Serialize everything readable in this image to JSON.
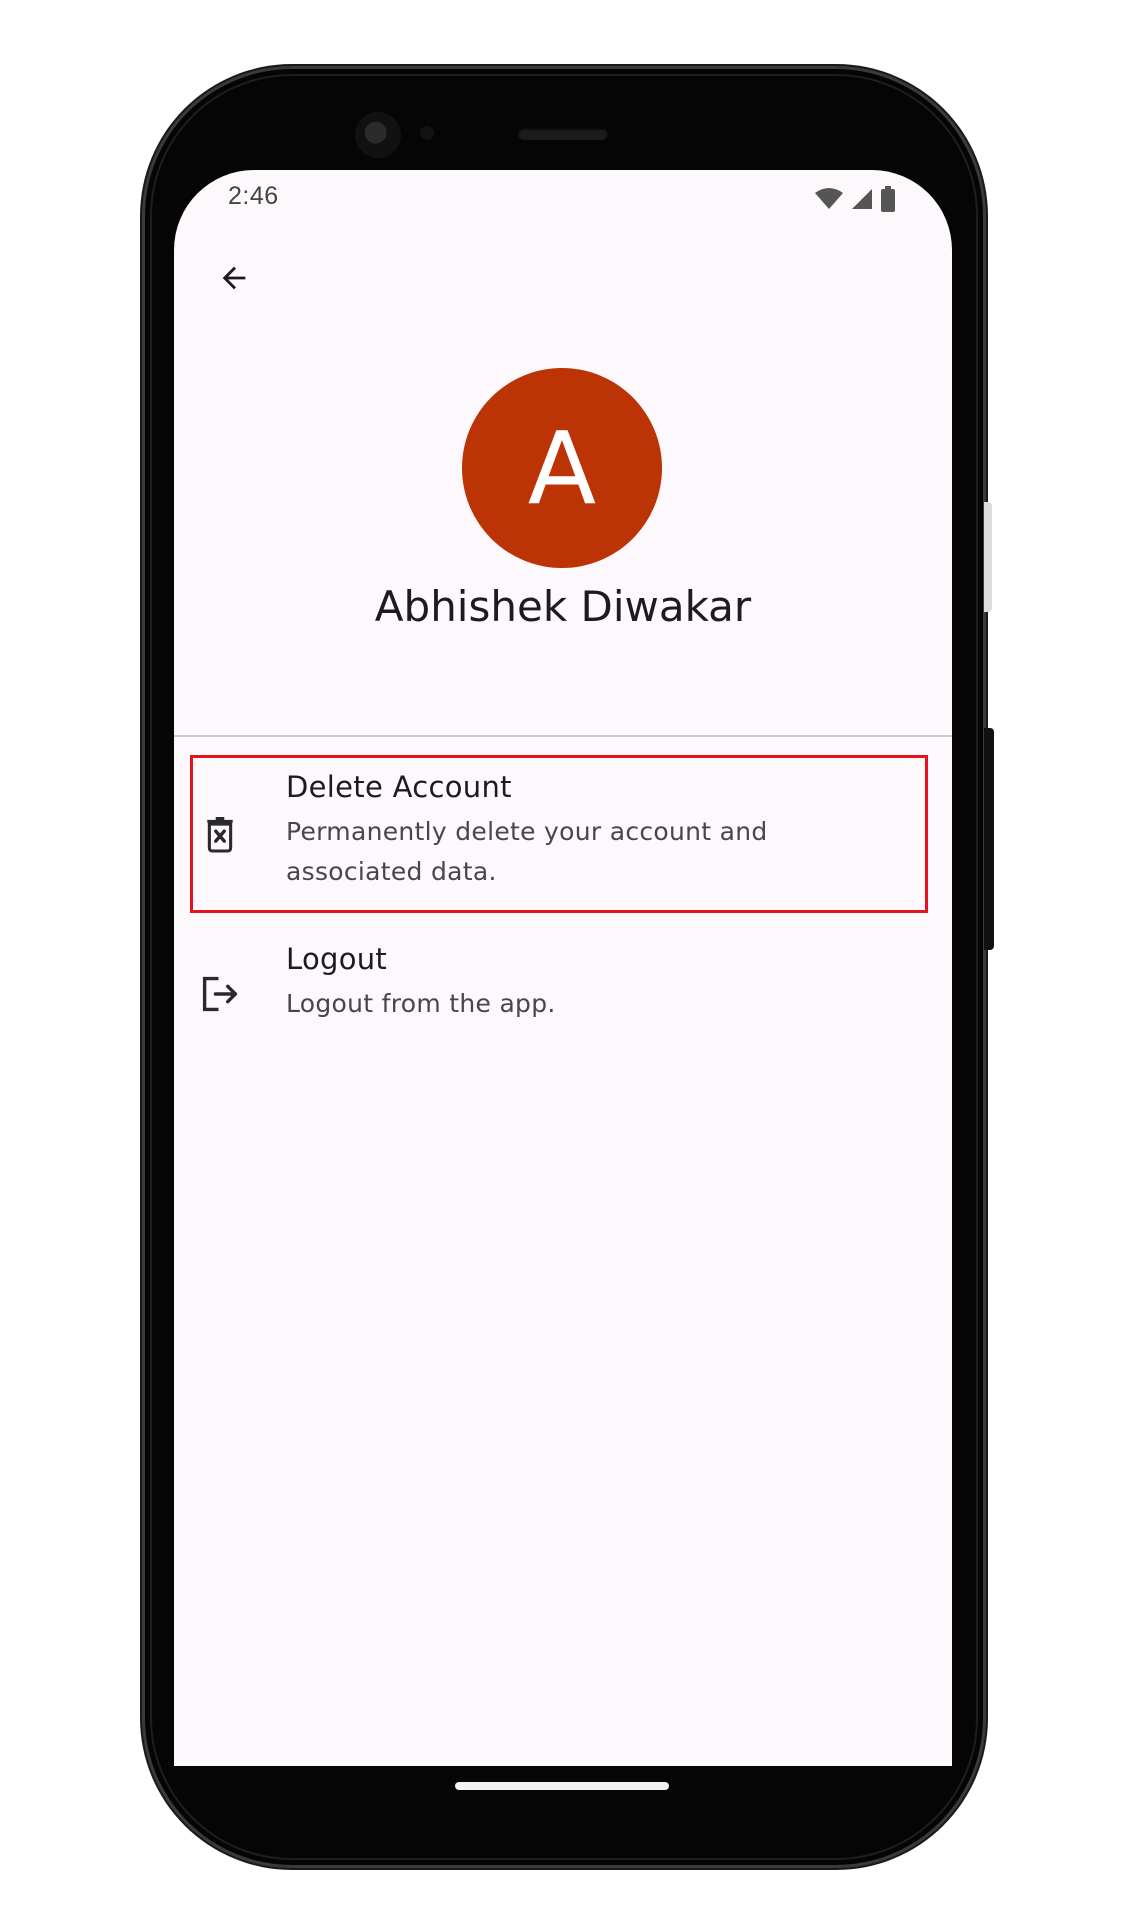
{
  "status_bar": {
    "time": "2:46",
    "icons": [
      "wifi-icon",
      "cellular-signal-icon",
      "battery-icon"
    ]
  },
  "app_bar": {
    "back_icon": "arrow-back-icon"
  },
  "profile": {
    "avatar_letter": "A",
    "avatar_color": "#bc3306",
    "name": "Abhishek Diwakar"
  },
  "menu": {
    "items": [
      {
        "icon": "delete-account-icon",
        "title": "Delete Account",
        "subtitle": "Permanently delete your account and associated data."
      },
      {
        "icon": "logout-icon",
        "title": "Logout",
        "subtitle": "Logout from the app."
      }
    ]
  },
  "colors": {
    "screen_background": "#fdf8fc",
    "highlight_border": "#e3121c",
    "text_primary": "#1c1b1f",
    "text_secondary": "#49454f"
  }
}
